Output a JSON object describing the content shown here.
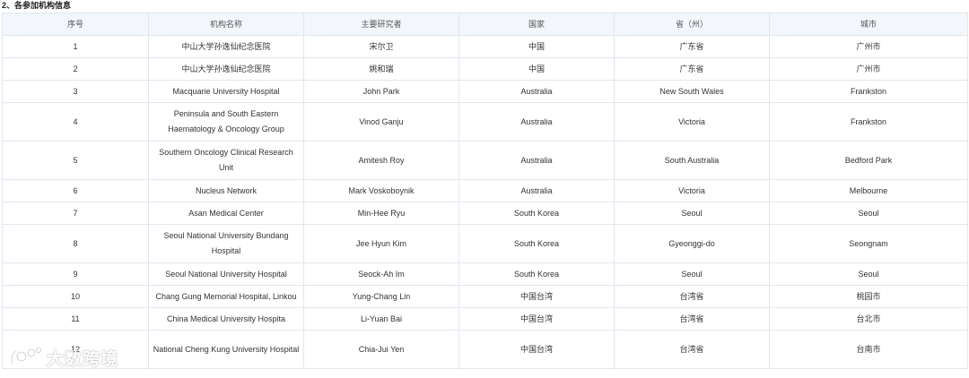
{
  "section": {
    "title": "2、各参加机构信息"
  },
  "table": {
    "headers": [
      "序号",
      "机构名称",
      "主要研究者",
      "国家",
      "省（州）",
      "城市"
    ],
    "rows": [
      {
        "no": "1",
        "institution": "中山大学孙逸仙纪念医院",
        "investigator": "宋尔卫",
        "country": "中国",
        "province": "广东省",
        "city": "广州市",
        "tall": false
      },
      {
        "no": "2",
        "institution": "中山大学孙逸仙纪念医院",
        "investigator": "姚和瑞",
        "country": "中国",
        "province": "广东省",
        "city": "广州市",
        "tall": false
      },
      {
        "no": "3",
        "institution": "Macquarie University Hospital",
        "investigator": "John Park",
        "country": "Australia",
        "province": "New South Wales",
        "city": "Frankston",
        "tall": false
      },
      {
        "no": "4",
        "institution": "Peninsula and South Eastern Haematology & Oncology Group",
        "investigator": "Vinod Ganju",
        "country": "Australia",
        "province": "Victoria",
        "city": "Frankston",
        "tall": true
      },
      {
        "no": "5",
        "institution": "Southern Oncology Clinical Research Unit",
        "investigator": "Amitesh Roy",
        "country": "Australia",
        "province": "South Australia",
        "city": "Bedford Park",
        "tall": true
      },
      {
        "no": "6",
        "institution": "Nucleus Network",
        "investigator": "Mark Voskoboynik",
        "country": "Australia",
        "province": "Victoria",
        "city": "Melbourne",
        "tall": false
      },
      {
        "no": "7",
        "institution": "Asan Medical Center",
        "investigator": "Min-Hee Ryu",
        "country": "South Korea",
        "province": "Seoul",
        "city": "Seoul",
        "tall": false
      },
      {
        "no": "8",
        "institution": "Seoul National University Bundang Hospital",
        "investigator": "Jee Hyun Kim",
        "country": "South Korea",
        "province": "Gyeonggi-do",
        "city": "Seongnam",
        "tall": true
      },
      {
        "no": "9",
        "institution": "Seoul National University Hospital",
        "investigator": "Seock-Ah Im",
        "country": "South Korea",
        "province": "Seoul",
        "city": "Seoul",
        "tall": false
      },
      {
        "no": "10",
        "institution": "Chang Gung Memorial Hospital, Linkou",
        "investigator": "Yung-Chang Lin",
        "country": "中国台湾",
        "province": "台湾省",
        "city": "桃园市",
        "tall": false
      },
      {
        "no": "11",
        "institution": "China Medical University Hospita",
        "investigator": "Li-Yuan Bai",
        "country": "中国台湾",
        "province": "台湾省",
        "city": "台北市",
        "tall": false
      },
      {
        "no": "12",
        "institution": "National Cheng Kung University Hospital",
        "investigator": "Chia-Jui Yen",
        "country": "中国台湾",
        "province": "台湾省",
        "city": "台南市",
        "tall": true
      }
    ]
  },
  "watermark": {
    "text": "大数跨境"
  }
}
